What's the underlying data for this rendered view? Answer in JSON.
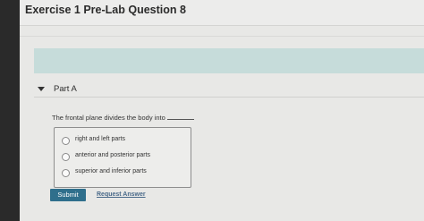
{
  "header": {
    "title": "Exercise 1 Pre-Lab Question 8"
  },
  "part": {
    "label": "Part A"
  },
  "question": {
    "text": "The frontal plane divides the body into"
  },
  "choices": [
    {
      "label": "right and left parts"
    },
    {
      "label": "anterior and posterior parts"
    },
    {
      "label": "superior and inferior parts"
    }
  ],
  "actions": {
    "submit_label": "Submit",
    "request_label": "Request Answer"
  }
}
